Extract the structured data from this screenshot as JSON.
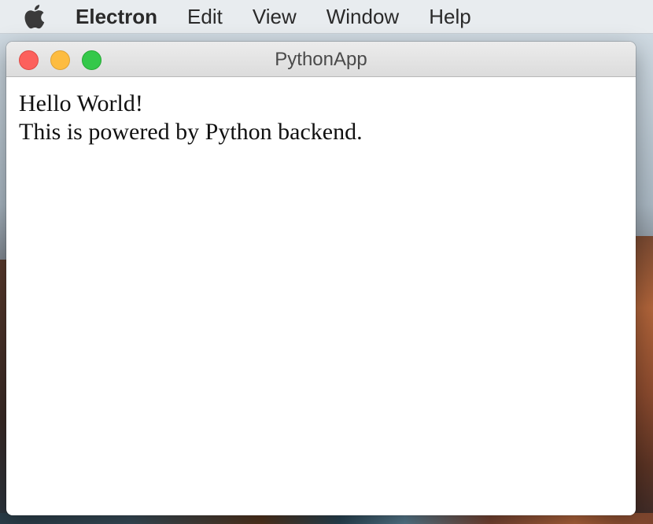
{
  "menubar": {
    "apple_icon": "apple-logo-icon",
    "app_name": "Electron",
    "items": [
      "Edit",
      "View",
      "Window",
      "Help"
    ]
  },
  "window": {
    "title": "PythonApp",
    "controls": {
      "close_color": "#fc605c",
      "minimize_color": "#fdbc40",
      "maximize_color": "#34c84a"
    }
  },
  "content": {
    "line1": "Hello World!",
    "line2": "This is powered by Python backend."
  }
}
